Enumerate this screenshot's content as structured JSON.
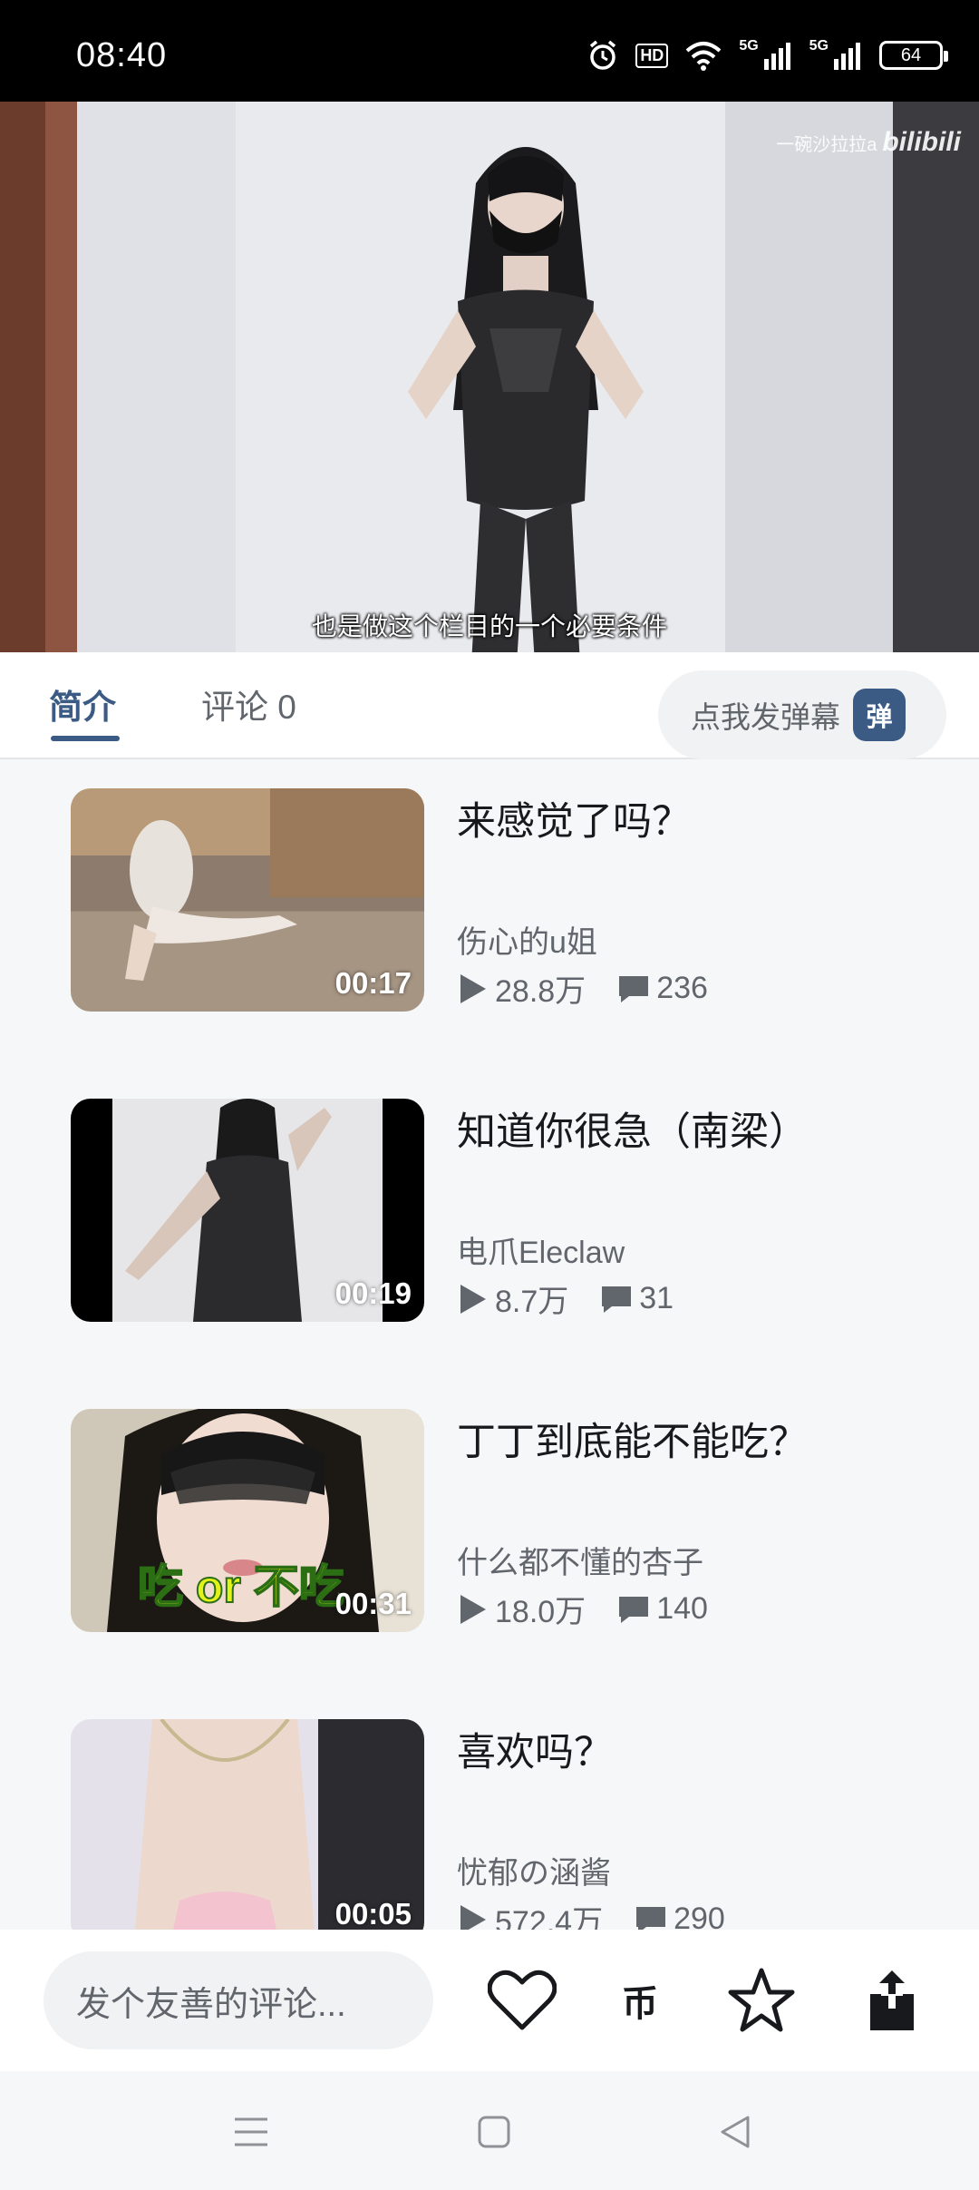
{
  "status_bar": {
    "time": "08:40",
    "hd_label": "HD",
    "signal_1_label": "5G",
    "signal_2_label": "5G",
    "battery": "64"
  },
  "video": {
    "subtitle": "也是做这个栏目的一个必要条件",
    "watermark_user": "一碗沙拉拉a",
    "watermark_brand": "bilibili"
  },
  "tabs": {
    "intro_label": "简介",
    "comments_label": "评论 0",
    "danmaku_label": "点我发弹幕",
    "danmaku_badge": "弹"
  },
  "related": [
    {
      "title": "来感觉了吗？",
      "author": "伤心的u姐",
      "views": "28.8万",
      "comments": "236",
      "duration": "00:17"
    },
    {
      "title": "知道你很急（南梁）",
      "author": "电爪Eleclaw",
      "views": "8.7万",
      "comments": "31",
      "duration": "00:19"
    },
    {
      "title": "丁丁到底能不能吃？",
      "author": "什么都不懂的杏子",
      "views": "18.0万",
      "comments": "140",
      "duration": "00:31",
      "thumb_text": "吃 or 不吃"
    },
    {
      "title": "喜欢吗？",
      "author": "忧郁の涵酱",
      "views": "572.4万",
      "comments": "290",
      "duration": "00:05"
    }
  ],
  "action_bar": {
    "comment_placeholder": "发个友善的评论...",
    "coin_label": "币"
  },
  "icons": {
    "like": "heart-icon",
    "coin": "coin-icon",
    "favorite": "star-icon",
    "share": "share-icon",
    "play": "play-icon",
    "comment": "comment-bubble-icon"
  },
  "colors": {
    "accent": "#3b5b84",
    "text_primary": "#18191c",
    "text_secondary": "#61666d"
  }
}
